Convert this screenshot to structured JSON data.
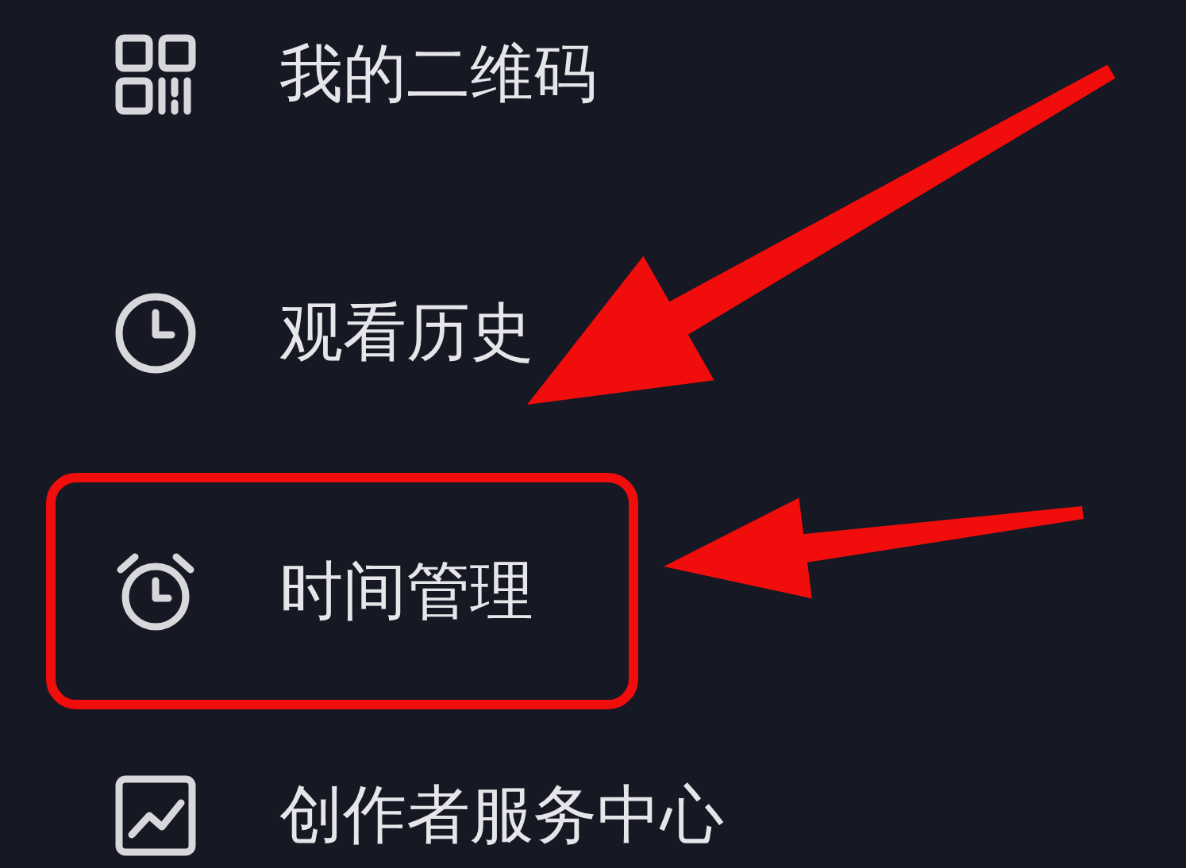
{
  "menu": {
    "items": [
      {
        "kind": "qr",
        "label": "我的二维码"
      },
      {
        "kind": "history",
        "label": "观看历史"
      },
      {
        "kind": "alarm",
        "label": "时间管理"
      },
      {
        "kind": "chart",
        "label": "创作者服务中心"
      }
    ]
  }
}
